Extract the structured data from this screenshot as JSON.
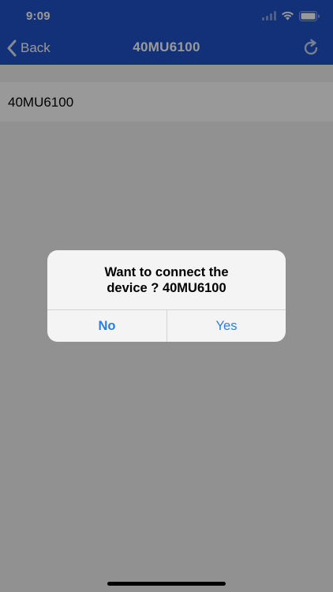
{
  "status_bar": {
    "time": "9:09"
  },
  "nav": {
    "back_label": "Back",
    "title": "40MU6100",
    "back_icon": "chevron-left-icon",
    "refresh_icon": "refresh-icon"
  },
  "devices": [
    {
      "name": "40MU6100"
    }
  ],
  "alert": {
    "message_line1": "Want to connect the",
    "message_line2": "device ? 40MU6100",
    "no_label": "No",
    "yes_label": "Yes"
  },
  "colors": {
    "header": "#1f52c9",
    "accent": "#2a7ee3",
    "background": "#f2f2f2"
  }
}
